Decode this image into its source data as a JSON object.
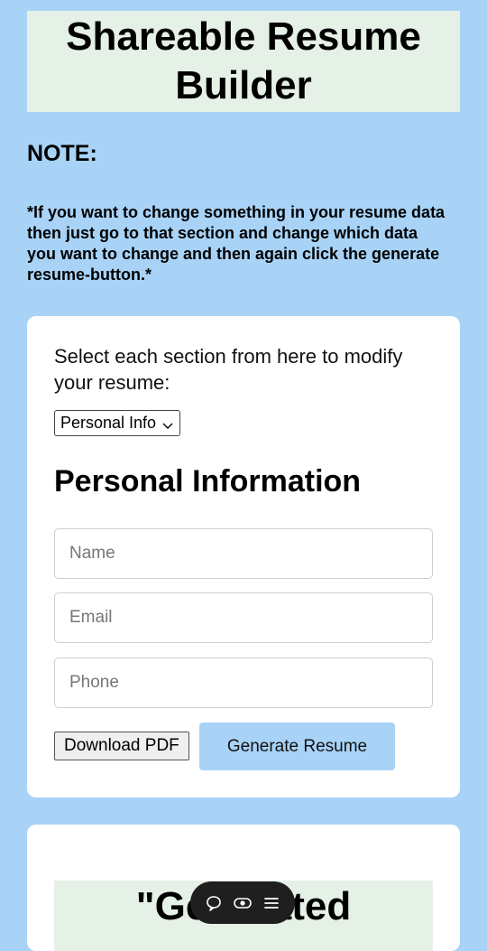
{
  "header": {
    "title": "Shareable Resume Builder"
  },
  "note": {
    "heading": "NOTE:",
    "text": "*If you want to change something in your resume data then just go to that section and change which data you want to change and then again click the generate resume-button.*"
  },
  "form": {
    "select_label": "Select each section from here to modify your resume:",
    "selected_section": "Personal Info",
    "section_heading": "Personal Information",
    "name_placeholder": "Name",
    "email_placeholder": "Email",
    "phone_placeholder": "Phone",
    "download_label": "Download PDF",
    "generate_label": "Generate Resume"
  },
  "generated": {
    "title_partial": "\"Generated"
  },
  "toolbar": {
    "icons": [
      "chat-bubble-icon",
      "toggle-icon",
      "menu-icon"
    ]
  }
}
